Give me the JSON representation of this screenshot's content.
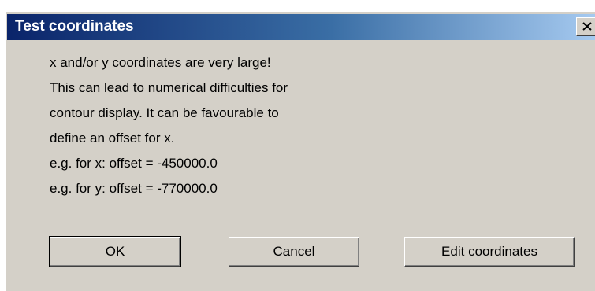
{
  "window": {
    "title": "Test coordinates",
    "close_icon": "close-icon"
  },
  "message": {
    "lines": [
      "x and/or y coordinates are very large!",
      "This can lead to numerical difficulties for",
      "contour display. It can be favourable to",
      "define an offset for x.",
      "e.g. for x: offset = -450000.0",
      "e.g. for y: offset = -770000.0"
    ]
  },
  "buttons": {
    "ok": "OK",
    "cancel": "Cancel",
    "edit_coordinates": "Edit coordinates"
  },
  "colors": {
    "dialog_background": "#d4d0c8",
    "titlebar_start": "#0a246a",
    "titlebar_end": "#a6caf0",
    "title_text": "#ffffff"
  }
}
